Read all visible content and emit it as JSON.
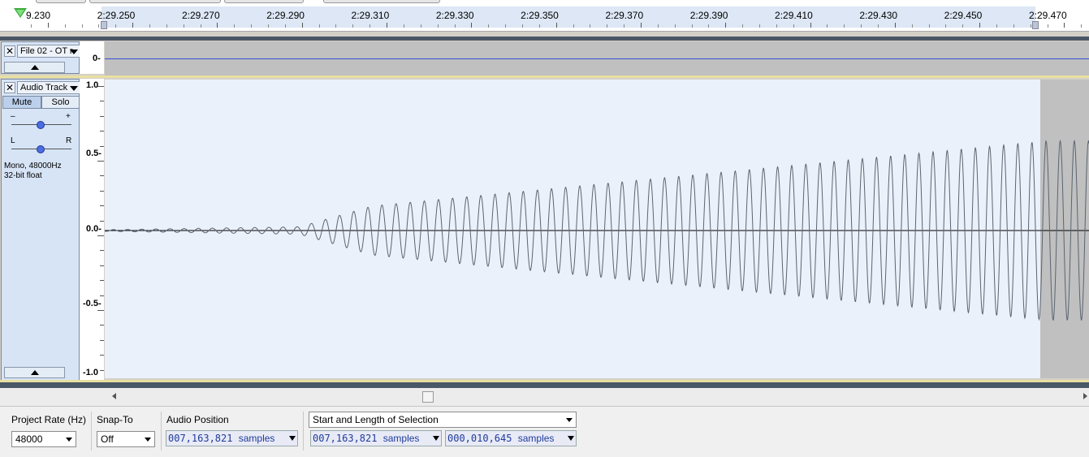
{
  "ruler": {
    "first_label": "9.230",
    "labels": [
      "2:29.250",
      "2:29.270",
      "2:29.290",
      "2:29.310",
      "2:29.330",
      "2:29.350",
      "2:29.370",
      "2:29.390",
      "2:29.410",
      "2:29.430",
      "2:29.450",
      "2:29.470"
    ]
  },
  "label_track": {
    "name": "File 02 - OT r",
    "close_glyph": "✕",
    "scale_label": "0-"
  },
  "audio_track": {
    "close_glyph": "✕",
    "name": "Audio Track",
    "mute_label": "Mute",
    "solo_label": "Solo",
    "gain_minus": "–",
    "gain_plus": "+",
    "pan_left": "L",
    "pan_right": "R",
    "info_line1": "Mono, 48000Hz",
    "info_line2": "32-bit float",
    "scale_labels": [
      "1.0",
      "0.5-",
      "0.0-",
      "-0.5-",
      "-1.0"
    ]
  },
  "toolbar": {
    "project_rate_label": "Project Rate (Hz)",
    "project_rate_value": "48000",
    "snap_to_label": "Snap-To",
    "snap_to_value": "Off",
    "audio_position_label": "Audio Position",
    "audio_position_value": "007,163,821",
    "selection_mode": "Start and Length of Selection",
    "selection_start_value": "007,163,821",
    "selection_length_value": "000,010,645",
    "unit_label": "samples"
  },
  "colors": {
    "waveform": "#5a6470",
    "selection_bg": "#ebf1fb",
    "time_text": "#1f3b9a"
  }
}
